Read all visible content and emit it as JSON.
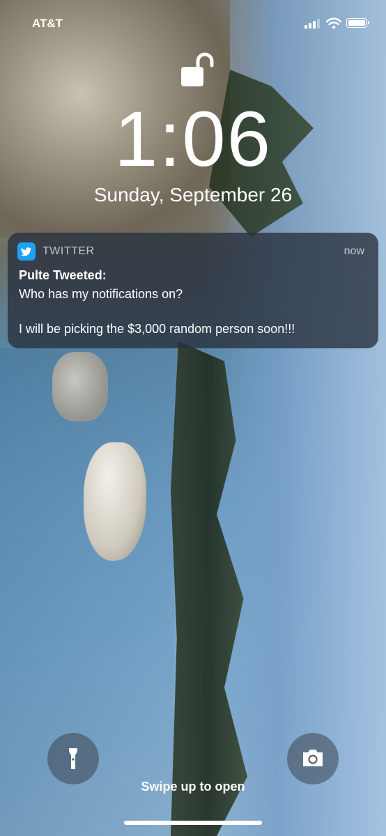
{
  "status_bar": {
    "carrier": "AT&T"
  },
  "lock_screen": {
    "time": "1:06",
    "date": "Sunday, September 26"
  },
  "notification": {
    "app_name": "TWITTER",
    "timestamp": "now",
    "title": "Pulte Tweeted:",
    "line1": "Who has my notifications on?",
    "line2": "I will be picking the $3,000 random person soon!!!",
    "app_icon": "twitter-bird-icon",
    "accent_color": "#1da1f2"
  },
  "footer": {
    "swipe_hint": "Swipe up to open",
    "left_button_icon": "flashlight-icon",
    "right_button_icon": "camera-icon"
  }
}
